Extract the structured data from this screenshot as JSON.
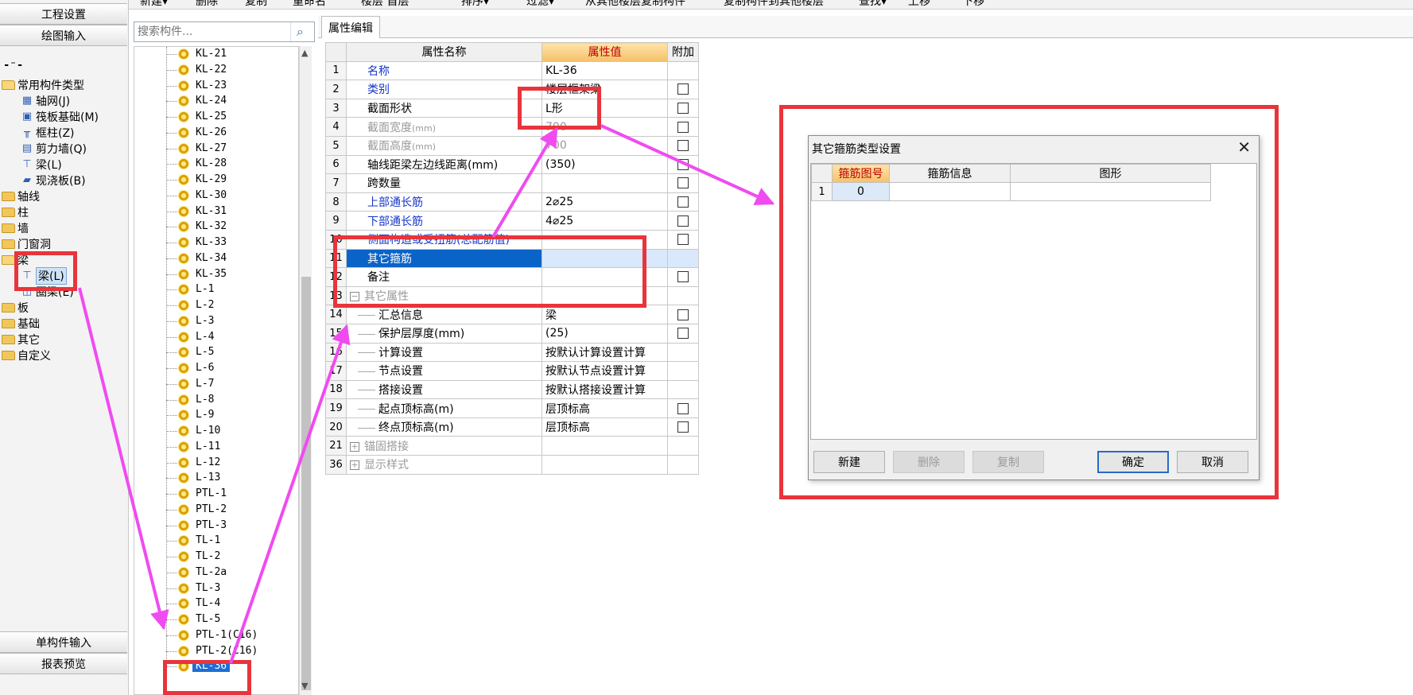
{
  "colors": {
    "annotation_red": "#e8343c",
    "annotation_magenta": "#f04bf0",
    "selection_blue": "#0a64c8",
    "header_highlight": "#f6c16a"
  },
  "left_panel": {
    "top_buttons": [
      "工程设置",
      "绘图输入"
    ],
    "toggle_icon": "collapse-expand-icon",
    "tree": [
      {
        "label": "常用构件类型",
        "type": "folder-open",
        "level": 0
      },
      {
        "label": "轴网(J)",
        "type": "leaf",
        "icon": "grid-icon",
        "level": 1
      },
      {
        "label": "筏板基础(M)",
        "type": "leaf",
        "icon": "raft-foundation-icon",
        "level": 1
      },
      {
        "label": "框柱(Z)",
        "type": "leaf",
        "icon": "column-icon",
        "level": 1
      },
      {
        "label": "剪力墙(Q)",
        "type": "leaf",
        "icon": "shear-wall-icon",
        "level": 1
      },
      {
        "label": "梁(L)",
        "type": "leaf",
        "icon": "beam-icon",
        "level": 1
      },
      {
        "label": "现浇板(B)",
        "type": "leaf",
        "icon": "slab-icon",
        "level": 1
      },
      {
        "label": "轴线",
        "type": "folder",
        "level": 0
      },
      {
        "label": "柱",
        "type": "folder",
        "level": 0
      },
      {
        "label": "墙",
        "type": "folder",
        "level": 0
      },
      {
        "label": "门窗洞",
        "type": "folder",
        "level": 0
      },
      {
        "label": "梁",
        "type": "folder-open",
        "level": 0
      },
      {
        "label": "梁(L)",
        "type": "leaf",
        "icon": "beam-icon",
        "level": 1,
        "selected": true
      },
      {
        "label": "圈梁(E)",
        "type": "leaf",
        "icon": "ring-beam-icon",
        "level": 1
      },
      {
        "label": "板",
        "type": "folder",
        "level": 0
      },
      {
        "label": "基础",
        "type": "folder",
        "level": 0
      },
      {
        "label": "其它",
        "type": "folder",
        "level": 0
      },
      {
        "label": "自定义",
        "type": "folder",
        "level": 0
      }
    ],
    "bottom_buttons": [
      "单构件输入",
      "报表预览"
    ]
  },
  "toolbar": {
    "items": [
      "新建▾",
      "删除",
      "复制",
      "重命名",
      "楼层 首层",
      "排序▾",
      "过滤▾",
      "从其他楼层复制构件",
      "复制构件到其他楼层",
      "查找▾",
      "上移",
      "下移"
    ]
  },
  "search": {
    "placeholder": "搜索构件..."
  },
  "component_list": {
    "items": [
      "KL-21",
      "KL-22",
      "KL-23",
      "KL-24",
      "KL-25",
      "KL-26",
      "KL-27",
      "KL-28",
      "KL-29",
      "KL-30",
      "KL-31",
      "KL-32",
      "KL-33",
      "KL-34",
      "KL-35",
      "L-1",
      "L-2",
      "L-3",
      "L-4",
      "L-5",
      "L-6",
      "L-7",
      "L-8",
      "L-9",
      "L-10",
      "L-11",
      "L-12",
      "L-13",
      "PTL-1",
      "PTL-2",
      "PTL-3",
      "TL-1",
      "TL-2",
      "TL-2a",
      "TL-3",
      "TL-4",
      "TL-5",
      "PTL-1(C16)",
      "PTL-2(C16)",
      "KL-36"
    ],
    "selected": "KL-36"
  },
  "property_editor": {
    "tab_label": "属性编辑",
    "headers": {
      "name": "属性名称",
      "value": "属性值",
      "extra": "附加"
    },
    "rows": [
      {
        "idx": "1",
        "name": "名称",
        "style": "blue",
        "value": "KL-36",
        "check": false
      },
      {
        "idx": "2",
        "name": "类别",
        "style": "blue",
        "value": "楼层框架梁",
        "check": true
      },
      {
        "idx": "3",
        "name": "截面形状",
        "style": "normal",
        "value": "L形",
        "check": true
      },
      {
        "idx": "4",
        "name": "截面宽度",
        "unit": "(mm)",
        "style": "gray",
        "value": "700",
        "value_style": "gray",
        "check": true
      },
      {
        "idx": "5",
        "name": "截面高度",
        "unit": "(mm)",
        "style": "gray",
        "value": "700",
        "value_style": "gray",
        "check": true
      },
      {
        "idx": "6",
        "name": "轴线距梁左边线距离(mm)",
        "style": "normal",
        "value": "(350)",
        "check": true
      },
      {
        "idx": "7",
        "name": "跨数量",
        "style": "normal",
        "value": "",
        "check": true
      },
      {
        "idx": "8",
        "name": "上部通长筋",
        "style": "blue",
        "value": "2⌀25",
        "check": true
      },
      {
        "idx": "9",
        "name": "下部通长筋",
        "style": "blue",
        "value": "4⌀25",
        "check": true
      },
      {
        "idx": "10",
        "name": "侧面构造或受扭筋(总配筋值)",
        "style": "blue",
        "value": "",
        "check": true
      },
      {
        "idx": "11",
        "name": "其它箍筋",
        "style": "selected",
        "value": "",
        "check": false
      },
      {
        "idx": "12",
        "name": "备注",
        "style": "normal",
        "value": "",
        "check": true
      },
      {
        "idx": "13",
        "name": "其它属性",
        "style": "group",
        "expander": "−",
        "value": "",
        "check": false
      },
      {
        "idx": "14",
        "name": "汇总信息",
        "style": "child",
        "value": "梁",
        "check": true
      },
      {
        "idx": "15",
        "name": "保护层厚度(mm)",
        "style": "child",
        "value": "(25)",
        "check": true
      },
      {
        "idx": "16",
        "name": "计算设置",
        "style": "child",
        "value": "按默认计算设置计算",
        "check": false
      },
      {
        "idx": "17",
        "name": "节点设置",
        "style": "child",
        "value": "按默认节点设置计算",
        "check": false
      },
      {
        "idx": "18",
        "name": "搭接设置",
        "style": "child",
        "value": "按默认搭接设置计算",
        "check": false
      },
      {
        "idx": "19",
        "name": "起点顶标高(m)",
        "style": "child",
        "value": "层顶标高",
        "check": true
      },
      {
        "idx": "20",
        "name": "终点顶标高(m)",
        "style": "child",
        "value": "层顶标高",
        "check": true
      },
      {
        "idx": "21",
        "name": "锚固搭接",
        "style": "group",
        "expander": "+",
        "value": "",
        "check": false
      },
      {
        "idx": "36",
        "name": "显示样式",
        "style": "group",
        "expander": "+",
        "value": "",
        "check": false
      }
    ]
  },
  "dialog": {
    "title": "其它箍筋类型设置",
    "close_icon": "close-icon",
    "headers": [
      "箍筋图号",
      "箍筋信息",
      "图形"
    ],
    "rows": [
      {
        "idx": "1",
        "code": "0",
        "info": "",
        "shape": ""
      }
    ],
    "buttons": {
      "new": "新建",
      "delete": "删除",
      "copy": "复制",
      "ok": "确定",
      "cancel": "取消"
    }
  }
}
